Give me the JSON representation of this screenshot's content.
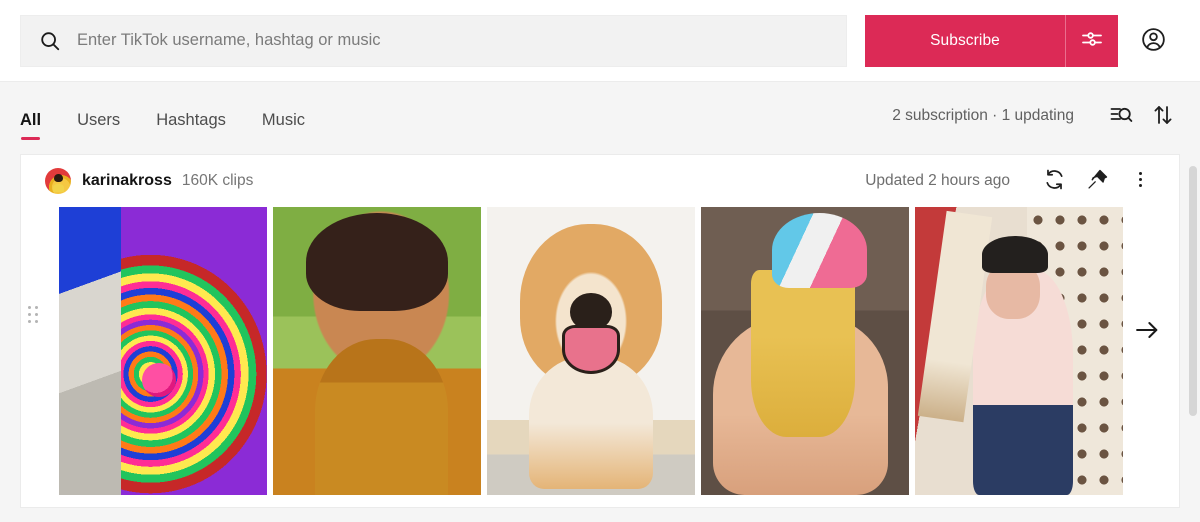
{
  "header": {
    "search": {
      "placeholder": "Enter TikTok username, hashtag or music",
      "value": "",
      "icon": "search-icon"
    },
    "subscribe_label": "Subscribe",
    "settings_icon": "sliders-icon",
    "account_icon": "account-circle-icon",
    "accent_color": "#dc2a56"
  },
  "tabbar": {
    "tabs": [
      {
        "label": "All",
        "active": true
      },
      {
        "label": "Users",
        "active": false
      },
      {
        "label": "Hashtags",
        "active": false
      },
      {
        "label": "Music",
        "active": false
      }
    ],
    "status": "2 subscription · 1 updating",
    "filter_icon": "filter-search-icon",
    "sort_icon": "sort-arrows-icon"
  },
  "card": {
    "username": "karinakross",
    "clips": "160K clips",
    "updated": "Updated 2 hours ago",
    "refresh_icon": "refresh-icon",
    "pin_icon": "pin-icon",
    "more_icon": "more-vertical-icon",
    "drag_handle_icon": "drag-handle-icon",
    "next_icon": "arrow-right-icon",
    "thumbnails": [
      {
        "alt": "rainbow-paint-pour-wall-art"
      },
      {
        "alt": "laughing-person-mustard-turtleneck"
      },
      {
        "alt": "smiling-shiba-inu-dog"
      },
      {
        "alt": "hand-holding-swirl-ice-cream-cone"
      },
      {
        "alt": "person-with-cricket-bat-and-cap"
      }
    ]
  }
}
